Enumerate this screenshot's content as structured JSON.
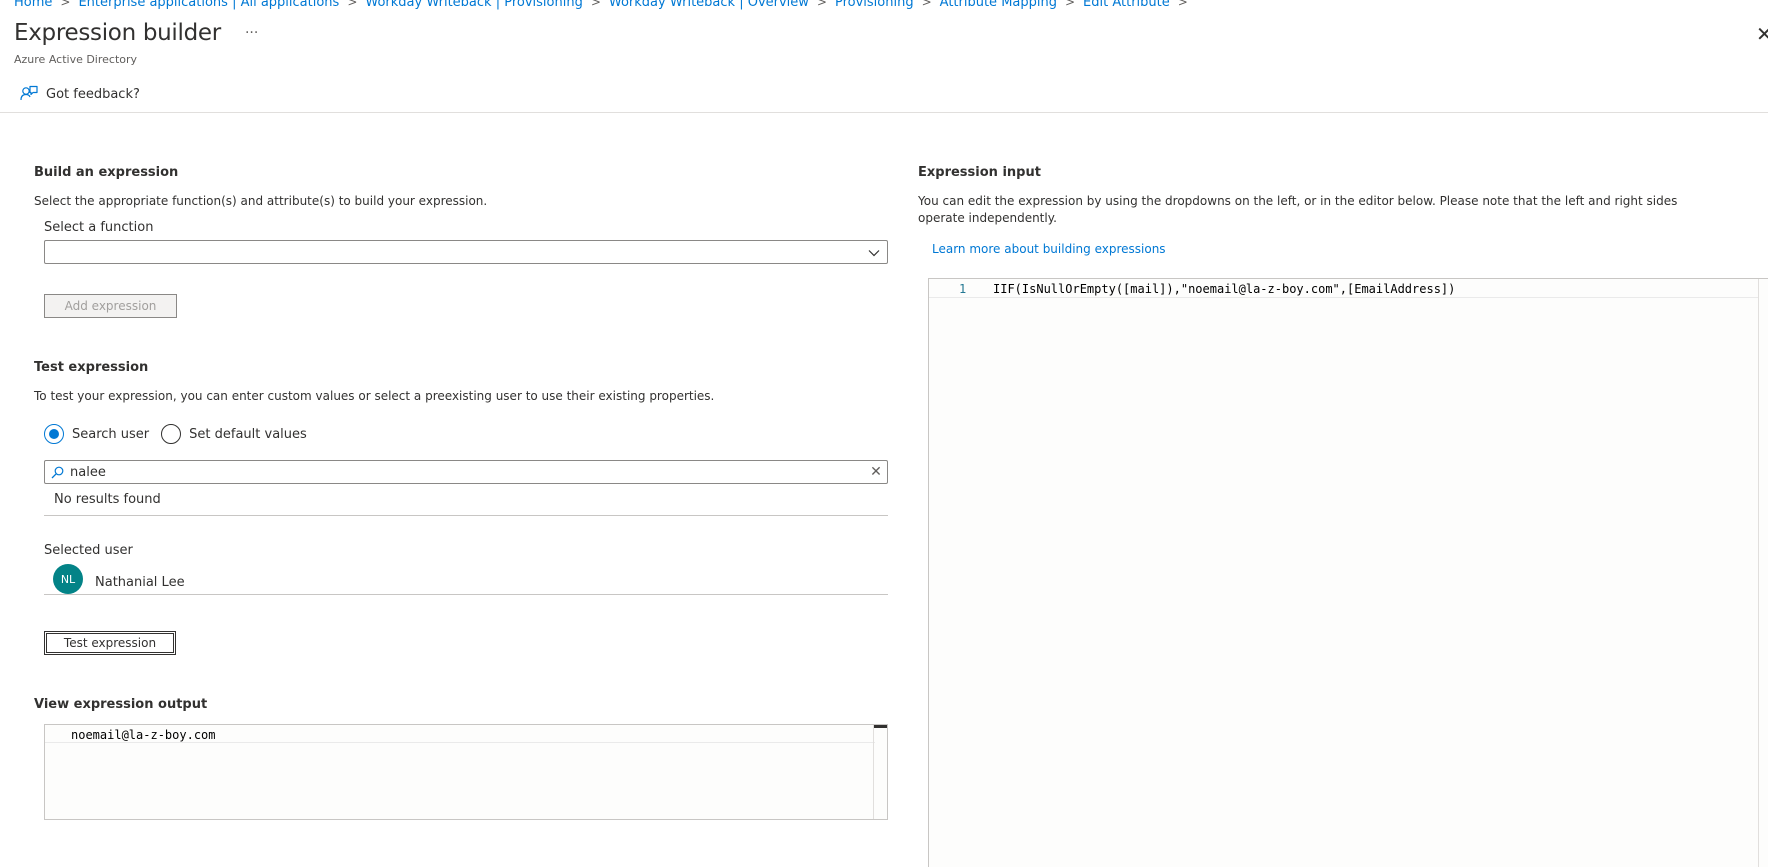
{
  "breadcrumb": [
    "Home",
    "Enterprise applications | All applications",
    "Workday Writeback | Provisioning",
    "Workday Writeback | Overview",
    "Provisioning",
    "Attribute Mapping",
    "Edit Attribute"
  ],
  "header": {
    "title": "Expression builder",
    "more": "···",
    "subtitle": "Azure Active Directory",
    "close": "✕"
  },
  "toolbar": {
    "feedback_label": "Got feedback?"
  },
  "build": {
    "title": "Build an expression",
    "description": "Select the appropriate function(s) and attribute(s) to build your expression.",
    "function_label": "Select a function",
    "function_value": "",
    "add_button": "Add expression"
  },
  "test": {
    "title": "Test expression",
    "description": "To test your expression, you can enter custom values or select a preexisting user to use their existing properties.",
    "radio_search": "Search user",
    "radio_default": "Set default values",
    "selected_radio": "Search user",
    "search_value": "nalee",
    "no_results": "No results found",
    "selected_user_label": "Selected user",
    "user_initials": "NL",
    "user_name": "Nathanial Lee",
    "test_button": "Test expression"
  },
  "output": {
    "title": "View expression output",
    "value": "noemail@la-z-boy.com"
  },
  "input": {
    "title": "Expression input",
    "description": "You can edit the expression by using the dropdowns on the left, or in the editor below. Please note that the left and right sides operate independently.",
    "learn_more": "Learn more about building expressions",
    "line_number": "1",
    "code": "IIF(IsNullOrEmpty([mail]),\"noemail@la-z-boy.com\",[EmailAddress])"
  },
  "colors": {
    "accent": "#0078d4",
    "avatar": "#038387",
    "text": "#323130"
  }
}
